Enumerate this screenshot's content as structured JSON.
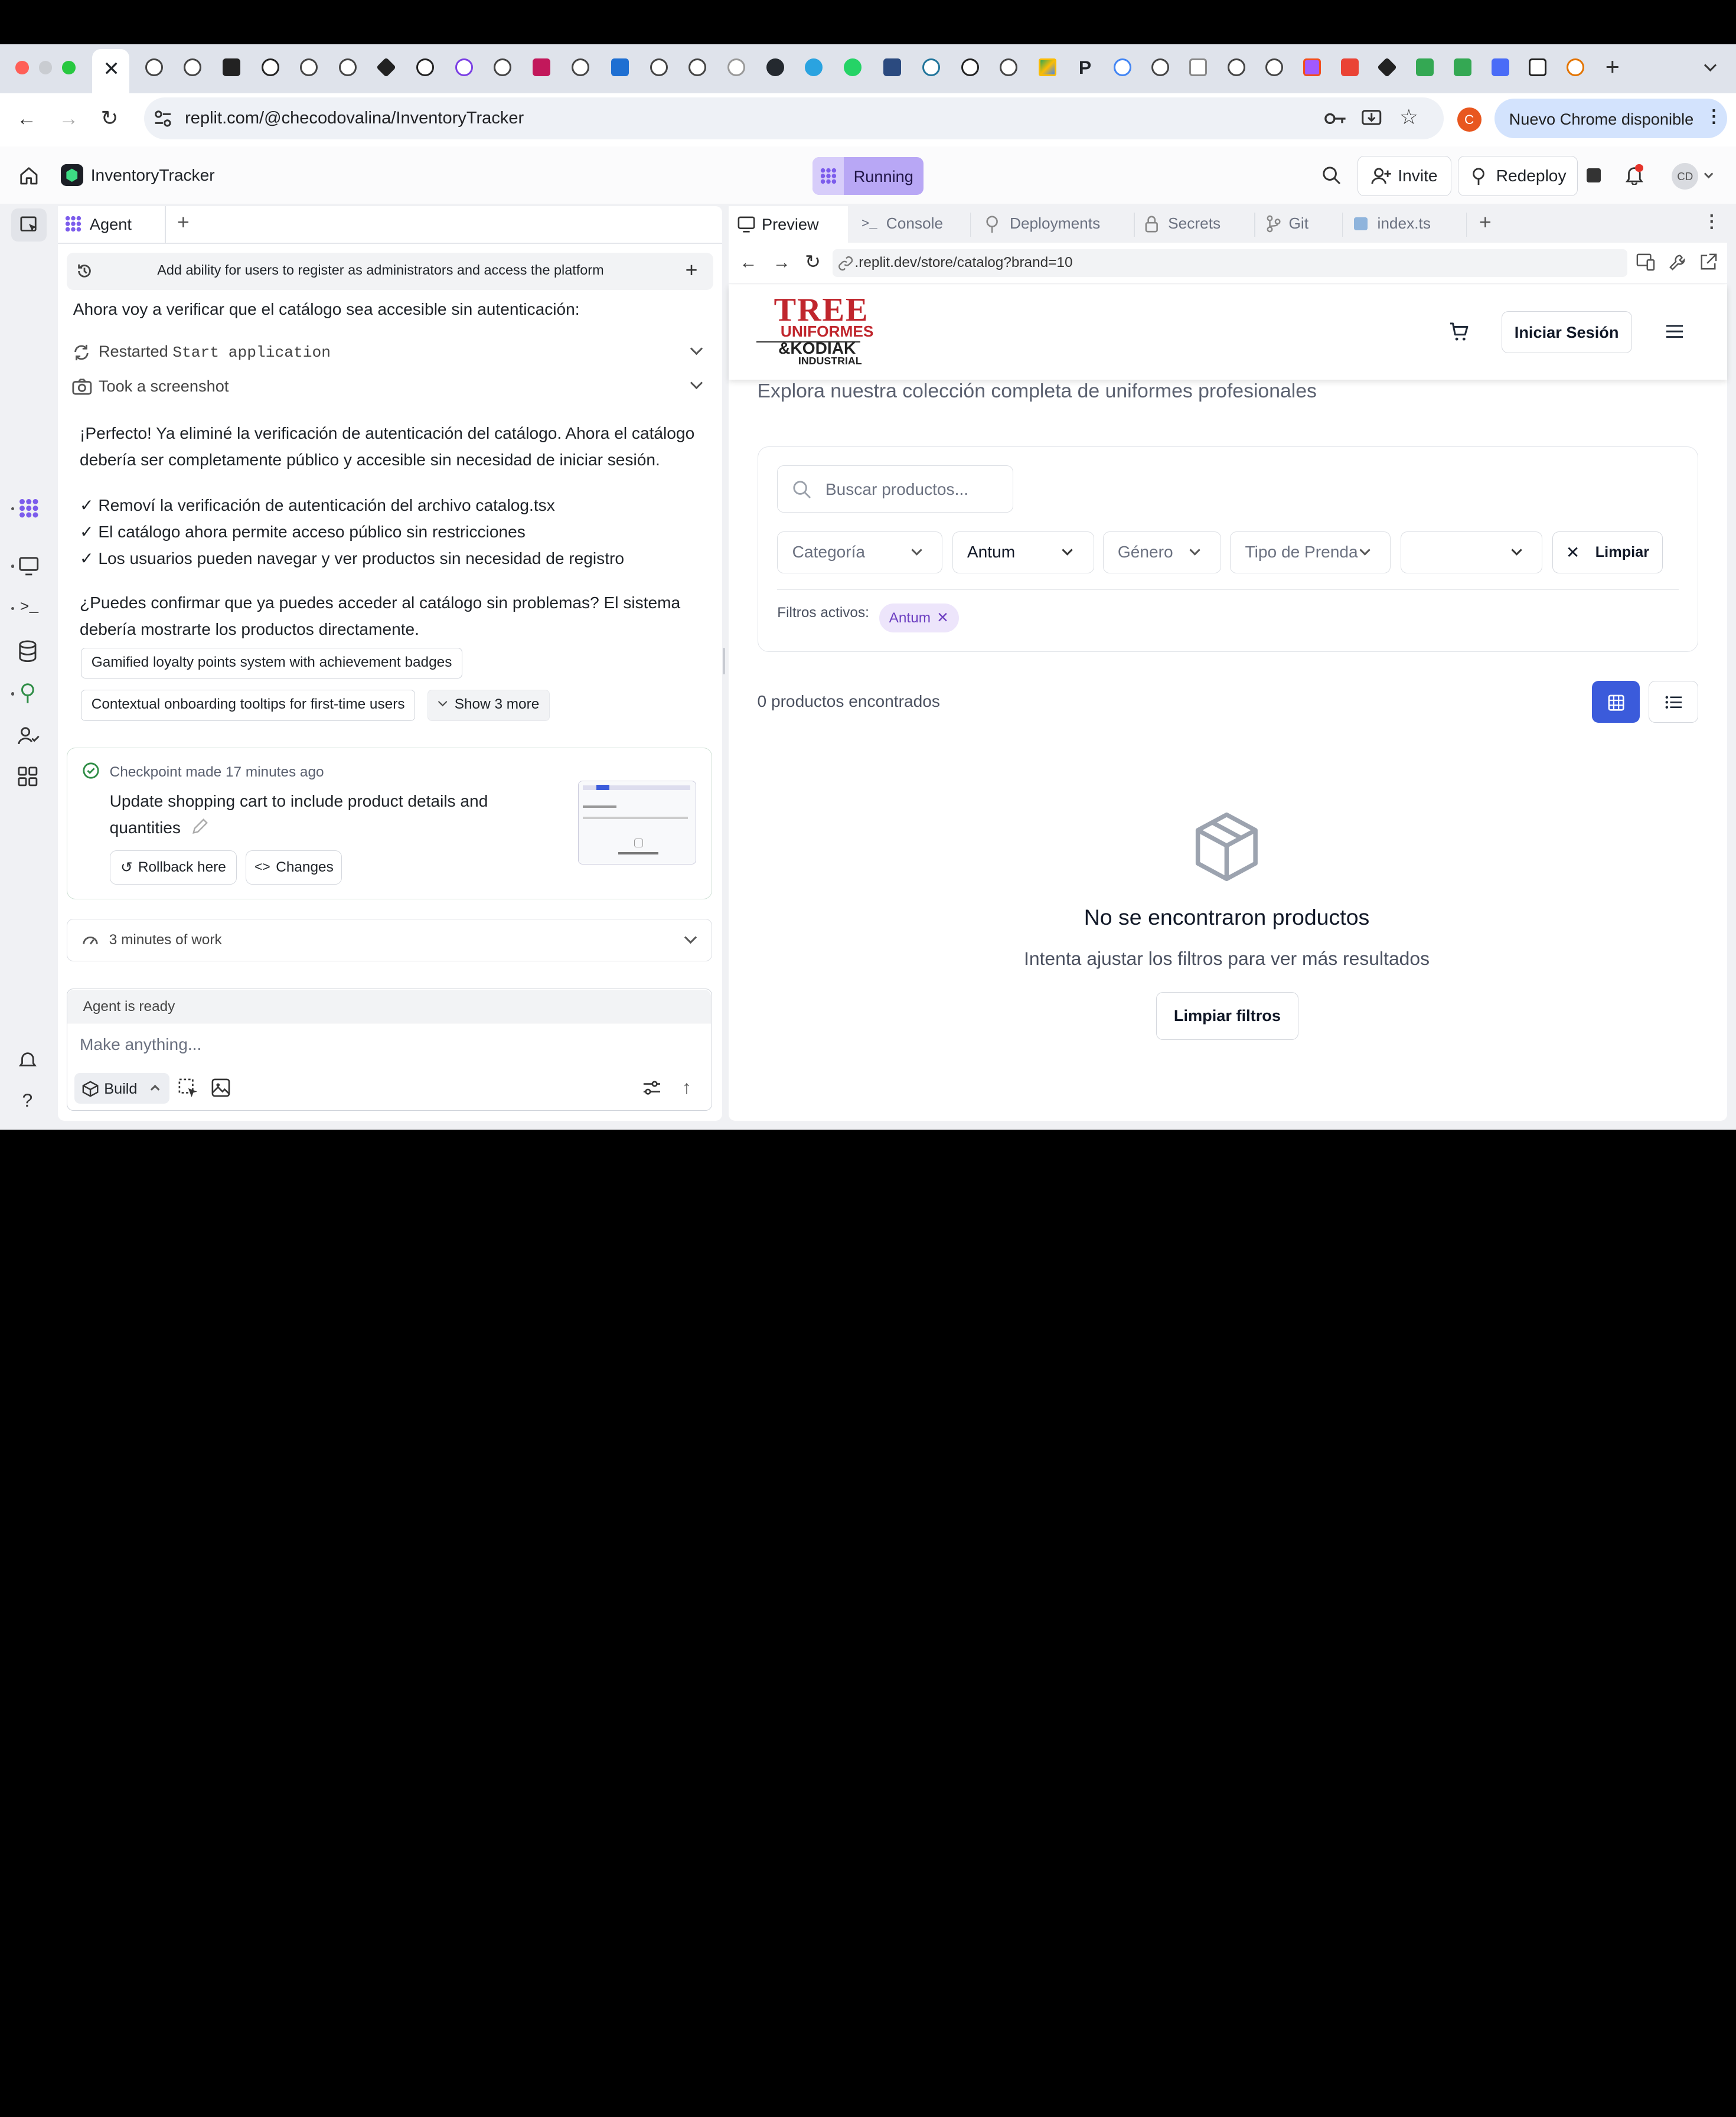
{
  "browser": {
    "url": "replit.com/@checodovalina/InventoryTracker",
    "chrome_update": "Nuevo Chrome disponible",
    "profile_initial": "C",
    "new_tab": "+",
    "tab_letter_p": "P"
  },
  "header": {
    "project_name": "InventoryTracker",
    "status": "Running",
    "invite": "Invite",
    "redeploy": "Redeploy",
    "avatar_initials": "CD"
  },
  "agent_panel": {
    "tab_label": "Agent",
    "add_tab": "+",
    "task_title": "Add ability for users to register as administrators and access the platform",
    "intro": "Ahora voy a verificar que el catálogo sea accesible sin autenticación:",
    "actions": [
      {
        "prefix": "Restarted ",
        "code": "Start application"
      },
      {
        "prefix": "Took a screenshot",
        "code": ""
      }
    ],
    "message_p1_line1": "¡Perfecto! Ya eliminé la verificación de autenticación del catálogo. Ahora el catálogo",
    "message_p1_line2": "debería ser completamente público y accesible sin necesidad de iniciar sesión.",
    "checklist": [
      "✓ Removí la verificación de autenticación del archivo catalog.tsx",
      "✓ El catálogo ahora permite acceso público sin restricciones",
      "✓ Los usuarios pueden navegar y ver productos sin necesidad de registro"
    ],
    "message_p2_line1": "¿Puedes confirmar que ya puedes acceder al catálogo sin problemas? El sistema",
    "message_p2_line2": "debería mostrarte los productos directamente.",
    "suggestions": [
      "Gamified loyalty points system with achievement badges",
      "Contextual onboarding tooltips for first-time users"
    ],
    "show_more": "Show 3 more",
    "checkpoint": {
      "label": "Checkpoint made",
      "time": "17 minutes ago",
      "title_line1": "Update shopping cart to include product details and",
      "title_line2": "quantities",
      "rollback": "Rollback here",
      "changes": "Changes"
    },
    "work_summary": "3 minutes of work",
    "status": "Agent is ready",
    "input_placeholder": "Make anything...",
    "mode": "Build"
  },
  "preview_panel": {
    "tabs": [
      "Preview",
      "Console",
      "Deployments",
      "Secrets",
      "Git",
      "index.ts"
    ],
    "add_tab": "+",
    "url": ".replit.dev/store/catalog?brand=10"
  },
  "store": {
    "logo_line1": "TREE",
    "logo_line2": "UNIFORMES",
    "logo_line3": "&KODIAK",
    "logo_line4": "INDUSTRIAL",
    "login": "Iniciar Sesión",
    "subtitle": "Explora nuestra colección completa de uniformes profesionales",
    "search_placeholder": "Buscar productos...",
    "filters": {
      "category": "Categoría",
      "brand": "Antum",
      "gender": "Género",
      "garment_type": "Tipo de Prenda",
      "extra": "",
      "clear": "Limpiar"
    },
    "active_filters_label": "Filtros activos:",
    "active_filter": "Antum",
    "results_count": "0 productos encontrados",
    "empty_title": "No se encontraron productos",
    "empty_text": "Intenta ajustar los filtros para ver más resultados",
    "clear_filters": "Limpiar filtros"
  },
  "colors": {
    "accent": "#3b5bdb",
    "running_bg": "#b8a7f5",
    "logo_red": "#c0262d",
    "chip_purple_bg": "#ede5fb",
    "chip_purple_text": "#6d3fc1"
  }
}
